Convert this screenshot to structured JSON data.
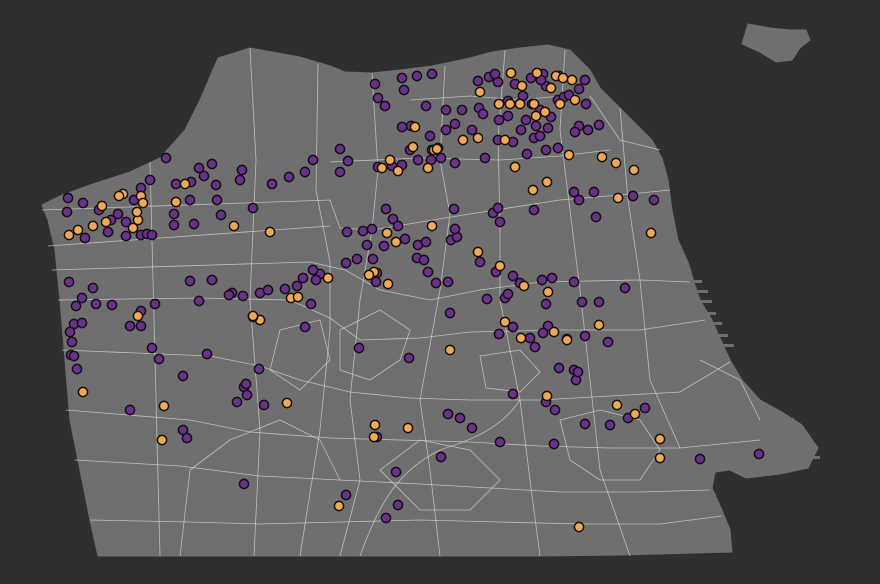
{
  "map": {
    "colors": {
      "background": "#2f2f2f",
      "land": "#6f6f6f",
      "boundary": "#d9d9d9",
      "category_a": "#6b2f8f",
      "category_b": "#f5a94a",
      "point_outline": "#111111"
    },
    "legend": [],
    "title": ""
  }
}
